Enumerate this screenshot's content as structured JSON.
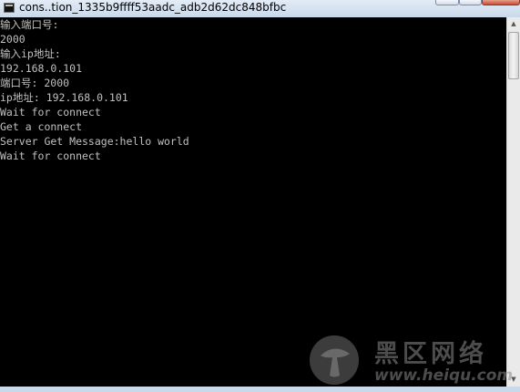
{
  "window": {
    "title": "cons..tion_1335b9ffff53aadc_adb2d62dc848bfbc"
  },
  "console": {
    "lines": [
      "输入端口号:",
      "2000",
      "输入ip地址:",
      "192.168.0.101",
      "端口号: 2000",
      "ip地址: 192.168.0.101",
      "Wait for connect",
      "Get a connect",
      "Server Get Message:hello world",
      "Wait for connect"
    ]
  },
  "watermark": {
    "brand_cn": "黑区网络",
    "url": "www.heiqu.com"
  },
  "colors": {
    "console_bg": "#000000",
    "console_text": "#c0c0c0",
    "frame": "#c9d9ea",
    "close_button": "#c44d34"
  },
  "icons": [
    "console-app-icon",
    "minimize-icon",
    "maximize-icon",
    "close-icon",
    "scroll-up-arrow-icon",
    "scroll-down-arrow-icon",
    "mushroom-logo-icon"
  ]
}
